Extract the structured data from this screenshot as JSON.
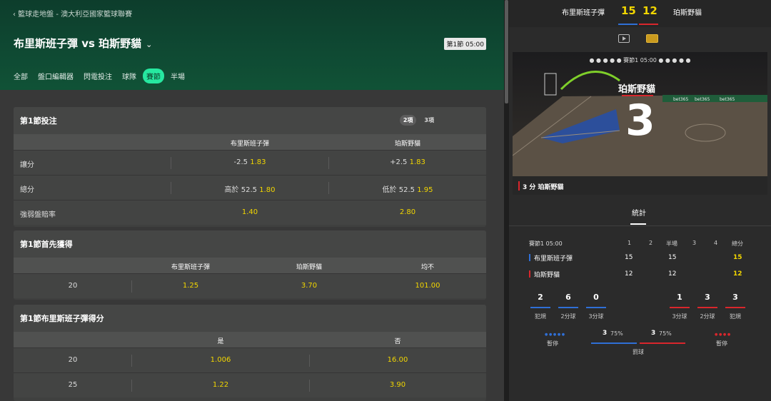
{
  "header": {
    "breadcrumb": "‹ 籃球走地盤 - 澳大利亞國家籃球聯賽",
    "match_title": "布里斯班子彈 vs 珀斯野貓",
    "chevron": "⌄",
    "period_badge": "第1節 05:00",
    "tabs": [
      "全部",
      "盤口編輯器",
      "閃電投注",
      "球隊",
      "賽節",
      "半場"
    ],
    "active_tab": "賽節"
  },
  "panels": {
    "p1": {
      "title": "第1節投注",
      "pills": [
        "2項",
        "3項"
      ],
      "col_home": "布里斯班子彈",
      "col_away": "珀斯野貓",
      "rows": [
        {
          "label": "讓分",
          "home_line": "-2.5",
          "home_odds": "1.83",
          "away_line": "+2.5",
          "away_odds": "1.83"
        },
        {
          "label": "總分",
          "home_line": "高於 52.5",
          "home_odds": "1.80",
          "away_line": "低於 52.5",
          "away_odds": "1.95"
        },
        {
          "label": "強弱盤賠率",
          "home_line": "",
          "home_odds": "1.40",
          "away_line": "",
          "away_odds": "2.80"
        }
      ]
    },
    "p2": {
      "title": "第1節首先獲得",
      "cols": [
        "布里斯班子彈",
        "珀斯野貓",
        "均不"
      ],
      "row": {
        "label": "20",
        "v1": "1.25",
        "v2": "3.70",
        "v3": "101.00"
      }
    },
    "p3": {
      "title": "第1節布里斯班子彈得分",
      "cols": [
        "是",
        "否"
      ],
      "rows": [
        {
          "label": "20",
          "yes": "1.006",
          "no": "16.00"
        },
        {
          "label": "25",
          "yes": "1.22",
          "no": "3.90"
        }
      ]
    }
  },
  "scoreboard": {
    "home": "布里斯班子彈",
    "away": "珀斯野貓",
    "home_score": "15",
    "away_score": "12",
    "court_period": "● ● ● ● ●  賽節1  05:00  ● ● ● ● ●",
    "court_team": "珀斯野貓",
    "court_points": "3",
    "event_text": "3 分  珀斯野貓",
    "stats_tab": "統計"
  },
  "stats": {
    "head": {
      "label": "賽節1  05:00",
      "c1": "1",
      "c2": "2",
      "c3": "半場",
      "c4": "3",
      "c5": "4",
      "c6": "總分"
    },
    "home": {
      "name": "布里斯班子彈",
      "q1": "15",
      "half": "15",
      "total": "15"
    },
    "away": {
      "name": "珀斯野貓",
      "q1": "12",
      "half": "12",
      "total": "12"
    },
    "home_stats": [
      {
        "v": "2",
        "l": "犯規"
      },
      {
        "v": "6",
        "l": "2分球"
      },
      {
        "v": "0",
        "l": "3分球"
      }
    ],
    "away_stats": [
      {
        "v": "1",
        "l": "3分球"
      },
      {
        "v": "3",
        "l": "2分球"
      },
      {
        "v": "3",
        "l": "犯規"
      }
    ],
    "timeout_label": "暫停",
    "ft_label": "罰球",
    "ft_home": "3",
    "ft_home_pct": "75%",
    "ft_away": "3",
    "ft_away_pct": "75%",
    "dots_home": "● ● ● ● ●",
    "dots_away": "● ● ● ●"
  },
  "colors": {
    "accent": "#26e8a0",
    "odds": "#f2d600",
    "home": "#2f6fd6",
    "away": "#d9262c"
  }
}
